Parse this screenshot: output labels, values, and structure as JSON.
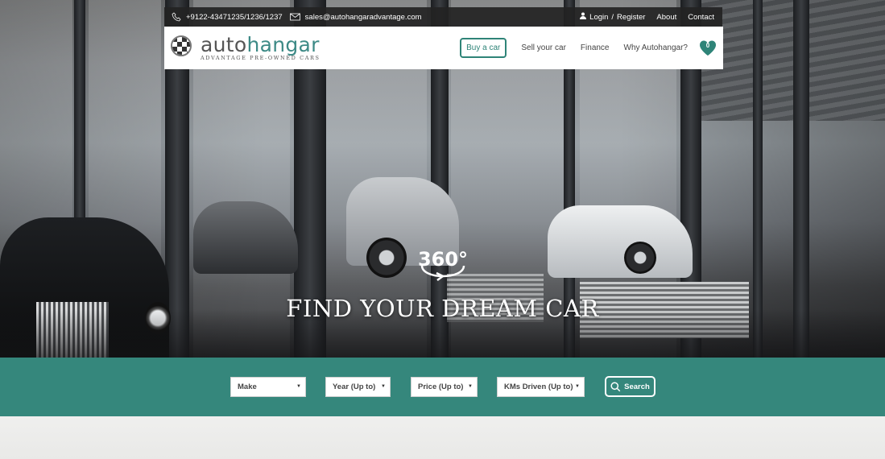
{
  "topbar": {
    "phone": "+9122-43471235/1236/1237",
    "email": "sales@autohangaradvantage.com",
    "login_label": "Login",
    "separator": "/",
    "register_label": "Register",
    "about_label": "About",
    "contact_label": "Contact"
  },
  "logo": {
    "brand_part1": "auto",
    "brand_part2": "hangar",
    "tagline": "ADVANTAGE PRE-OWNED CARS"
  },
  "nav": {
    "items": [
      "Buy a car",
      "Sell your car",
      "Finance",
      "Why Autohangar?"
    ],
    "wishlist_count": "0"
  },
  "hero": {
    "badge_text": "360°",
    "headline": "FIND YOUR DREAM CAR"
  },
  "search": {
    "make_placeholder": "Make",
    "year_placeholder": "Year (Up to)",
    "price_placeholder": "Price (Up to)",
    "kms_placeholder": "KMs Driven (Up to)",
    "button_label": "Search"
  },
  "colors": {
    "brand_teal": "#35877c",
    "topbar_bg": "#232323"
  }
}
